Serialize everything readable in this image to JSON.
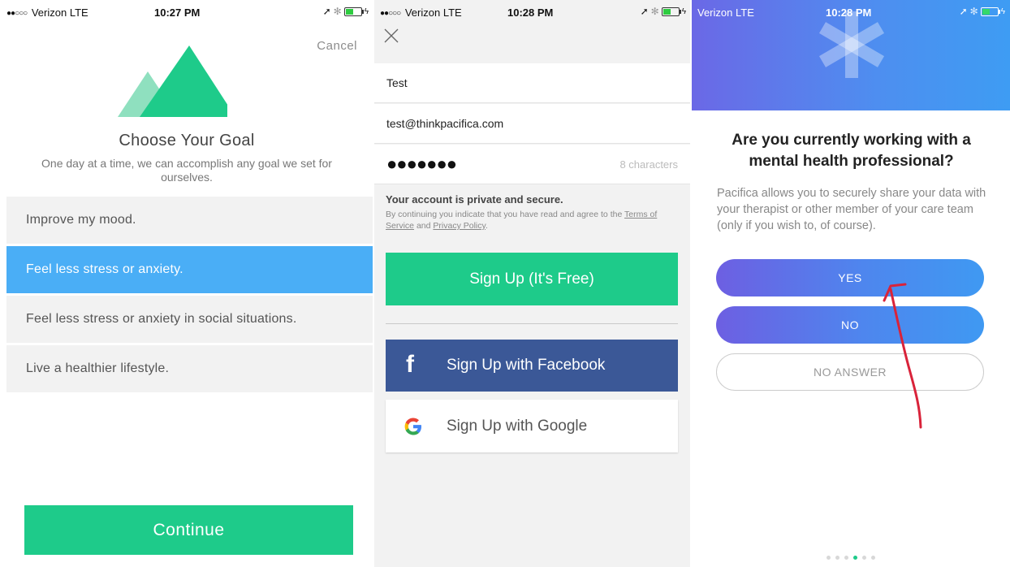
{
  "screen1": {
    "status": {
      "carrier": "Verizon",
      "network": "LTE",
      "time": "10:27 PM"
    },
    "cancel_label": "Cancel",
    "title": "Choose Your Goal",
    "subtitle": "One day at a time, we can accomplish any goal we set for ourselves.",
    "goals": [
      {
        "label": "Improve my mood.",
        "selected": false
      },
      {
        "label": "Feel less stress or anxiety.",
        "selected": true
      },
      {
        "label": "Feel less stress or anxiety in social situations.",
        "selected": false
      },
      {
        "label": "Live a healthier lifestyle.",
        "selected": false
      }
    ],
    "continue_label": "Continue",
    "colors": {
      "accent": "#1ecb8a",
      "selected": "#4aaef6"
    }
  },
  "screen2": {
    "status": {
      "carrier": "Verizon",
      "network": "LTE",
      "time": "10:28 PM"
    },
    "name_value": "Test",
    "email_value": "test@thinkpacifica.com",
    "password_mask": "●●●●●●●",
    "password_hint": "8 characters",
    "privacy_heading": "Your account is private and secure.",
    "privacy_body_prefix": "By continuing you indicate that you have read and agree to the",
    "terms_link": "Terms of Service",
    "privacy_and": "and",
    "privacy_link": "Privacy Policy",
    "privacy_end": ".",
    "signup_label": "Sign Up (It's Free)",
    "facebook_label": "Sign Up with Facebook",
    "google_label": "Sign Up with Google",
    "colors": {
      "facebook": "#3b5897",
      "accent": "#1ecb8a"
    }
  },
  "screen3": {
    "status": {
      "carrier": "Verizon",
      "network": "LTE",
      "time": "10:28 PM"
    },
    "question": "Are you currently working with a mental health professional?",
    "description": "Pacifica allows you to securely share your data with your therapist or other member of your care team (only if you wish to, of course).",
    "options": {
      "yes": "YES",
      "no": "NO",
      "no_answer": "NO ANSWER"
    },
    "page_indicator": {
      "total": 6,
      "current": 4
    }
  }
}
